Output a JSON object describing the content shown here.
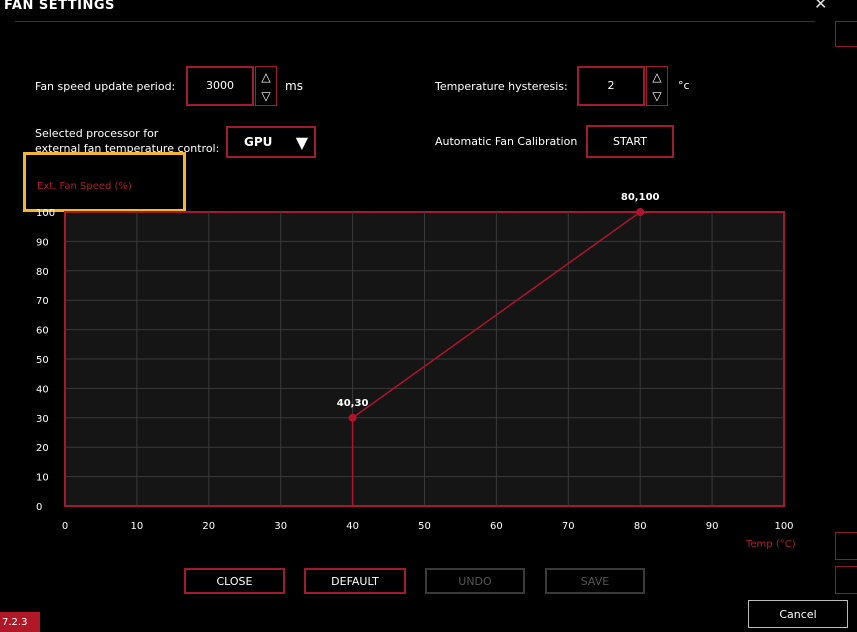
{
  "window": {
    "title": "FAN SETTINGS",
    "close_glyph": "✕"
  },
  "settings": {
    "update_period_label": "Fan speed update period:",
    "update_period_value": "3000",
    "update_period_unit": "ms",
    "hysteresis_label": "Temperature hysteresis:",
    "hysteresis_value": "2",
    "hysteresis_unit": "°c",
    "processor_label_line1": "Selected processor for",
    "processor_label_line2": "external fan temperature control:",
    "processor_value": "GPU",
    "calibration_label": "Automatic Fan Calibration",
    "calibration_button": "START",
    "spin_up_glyph": "△",
    "spin_down_glyph": "▽",
    "dropdown_glyph": "▼"
  },
  "chart_data": {
    "type": "line",
    "ylabel": "Ext. Fan Speed (%)",
    "xlabel": "Temp (°C)",
    "xlim": [
      0,
      100
    ],
    "ylim": [
      0,
      100
    ],
    "x_ticks": [
      0,
      10,
      20,
      30,
      40,
      50,
      60,
      70,
      80,
      90,
      100
    ],
    "y_ticks": [
      0,
      10,
      20,
      30,
      40,
      50,
      60,
      70,
      80,
      90,
      100
    ],
    "grid": true,
    "series": [
      {
        "points": [
          {
            "x": 40,
            "y": 0
          },
          {
            "x": 40,
            "y": 30
          },
          {
            "x": 80,
            "y": 100
          }
        ]
      }
    ],
    "point_labels": [
      {
        "x": 40,
        "y": 30,
        "label": "40,30"
      },
      {
        "x": 80,
        "y": 100,
        "label": "80,100"
      }
    ],
    "colors": {
      "line": "#b0142c",
      "grid": "#3a3a3a",
      "plot_bg": "#151515",
      "frame": "#a01a30"
    }
  },
  "buttons": {
    "close": "CLOSE",
    "default": "DEFAULT",
    "undo": "UNDO",
    "save": "SAVE",
    "cancel": "Cancel"
  },
  "status": {
    "version": "7.2.3"
  }
}
